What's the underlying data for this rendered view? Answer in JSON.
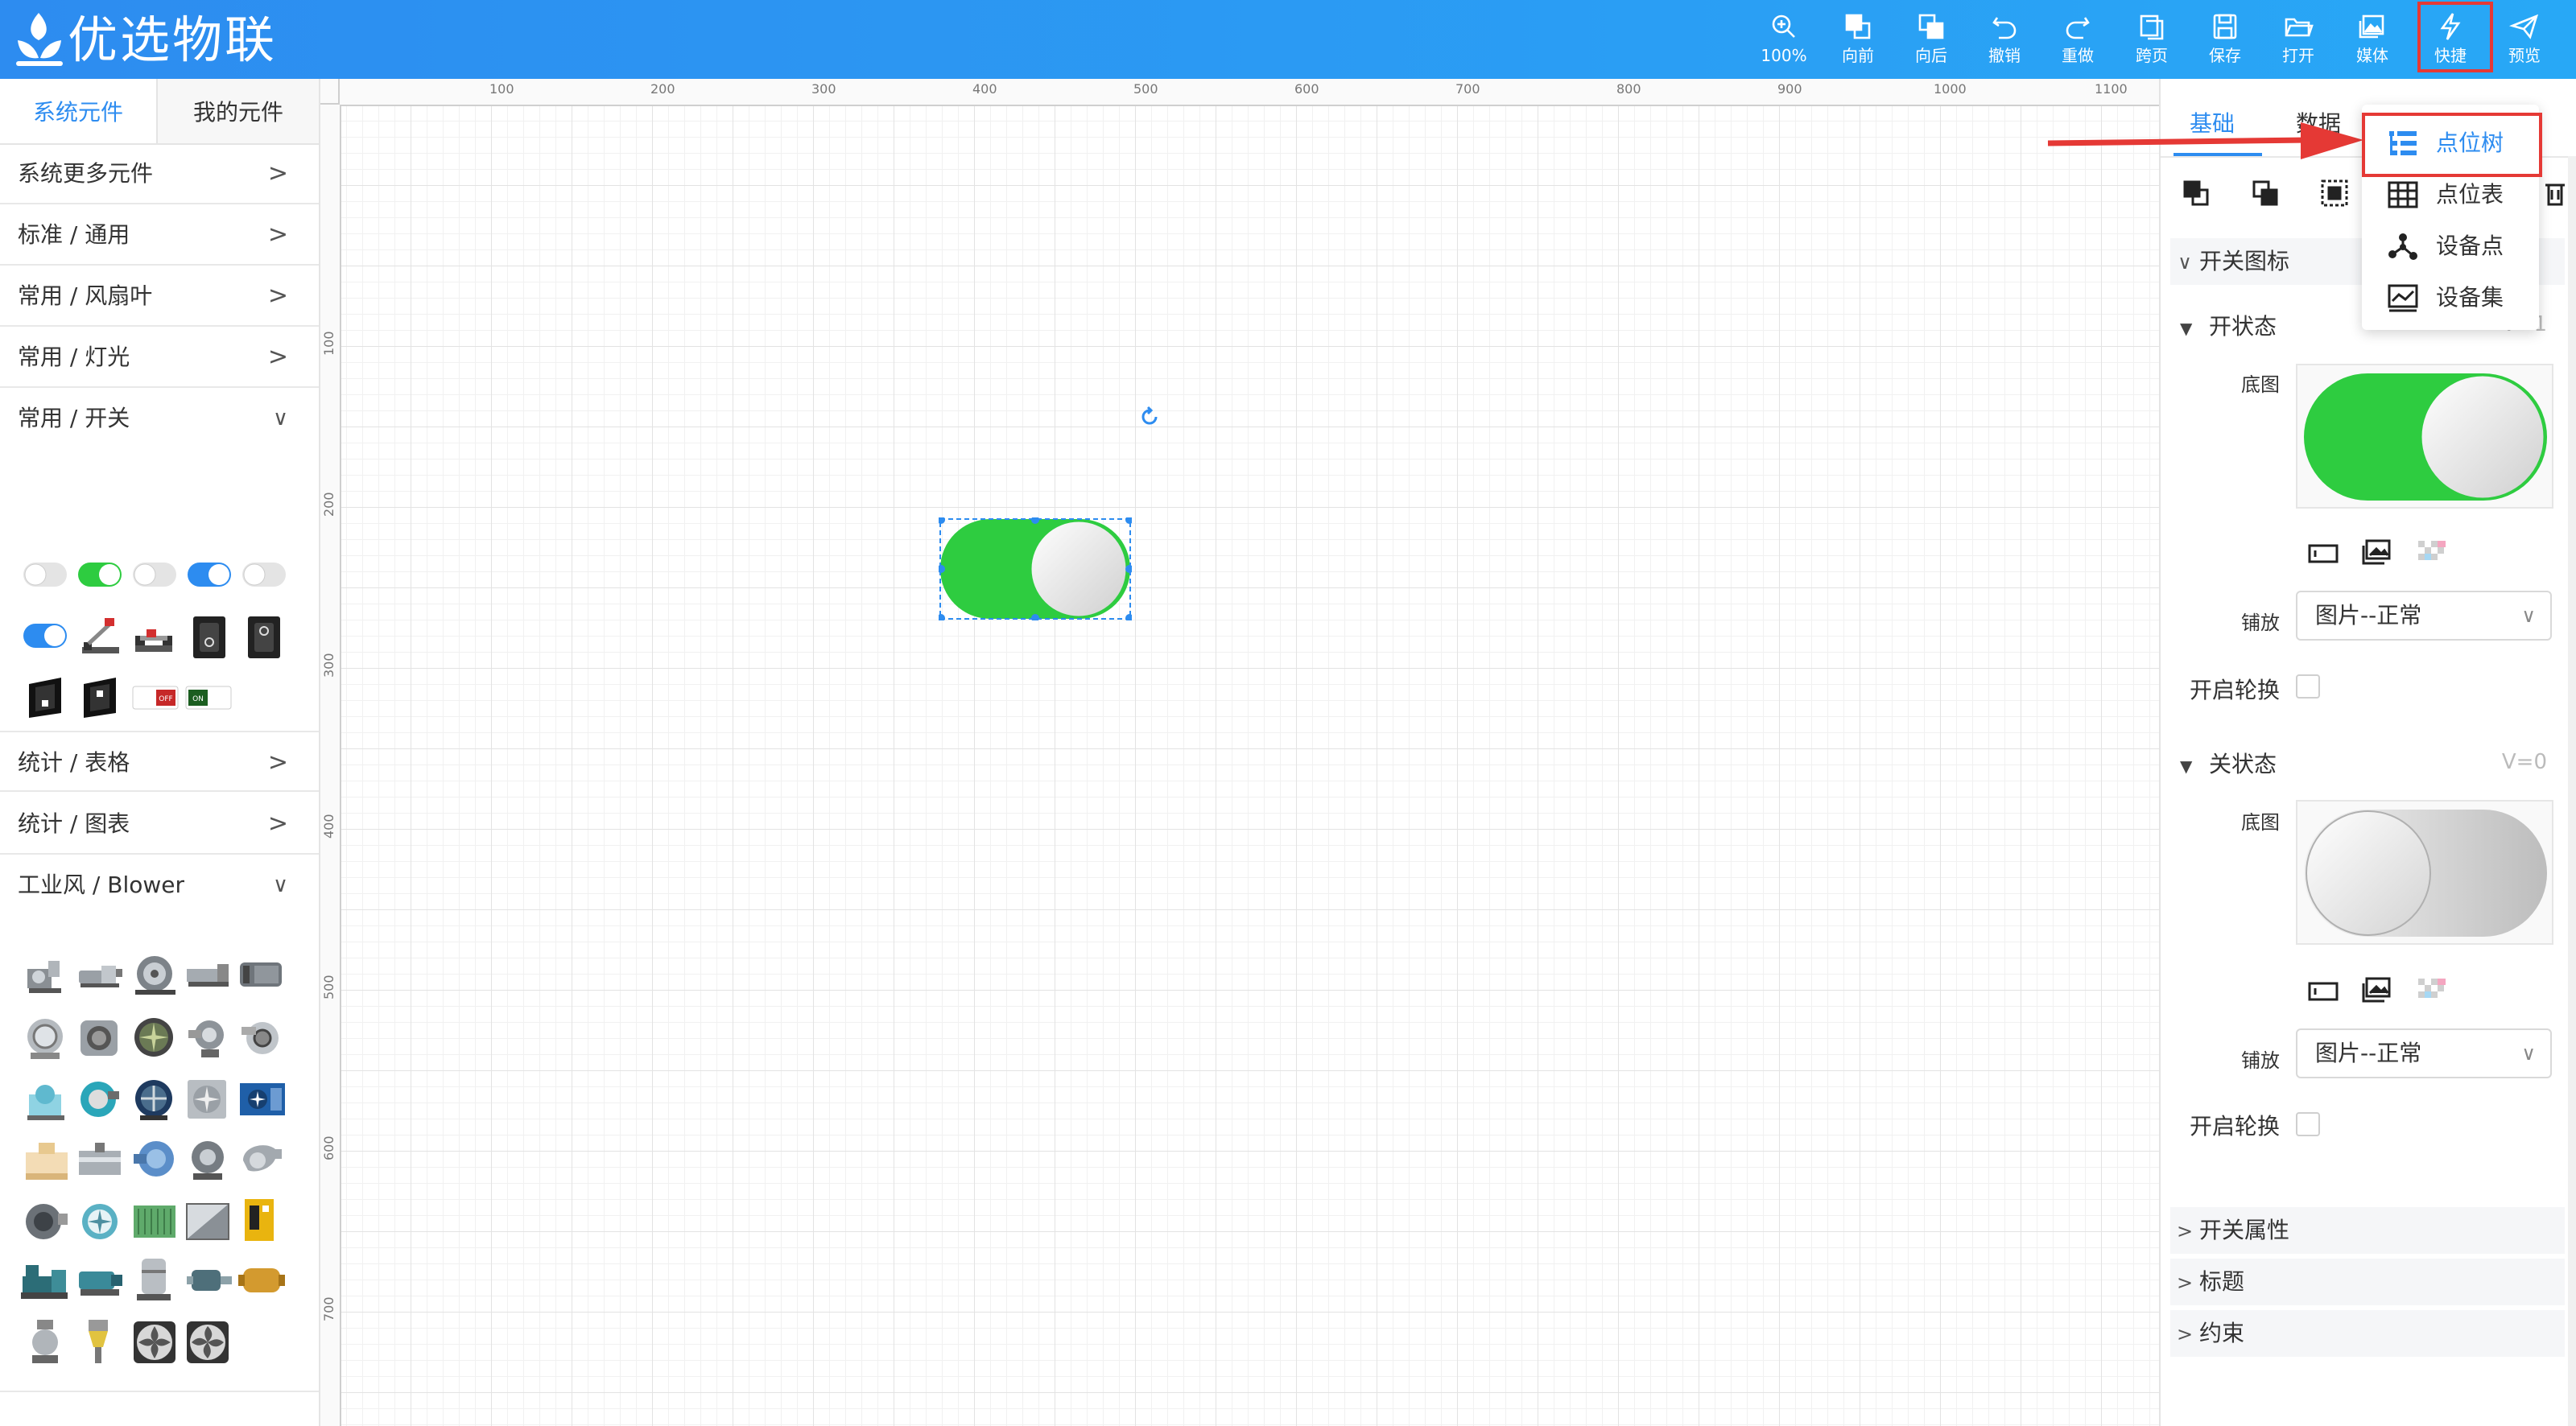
{
  "app": {
    "title": "优选物联"
  },
  "toolbar": [
    {
      "id": "zoom",
      "label": "100%",
      "icon": "zoom-in-icon"
    },
    {
      "id": "forward",
      "label": "向前",
      "icon": "bring-forward-icon"
    },
    {
      "id": "backward",
      "label": "向后",
      "icon": "send-backward-icon"
    },
    {
      "id": "undo",
      "label": "撤销",
      "icon": "undo-icon"
    },
    {
      "id": "redo",
      "label": "重做",
      "icon": "redo-icon"
    },
    {
      "id": "crosspage",
      "label": "跨页",
      "icon": "copy-page-icon"
    },
    {
      "id": "save",
      "label": "保存",
      "icon": "save-icon"
    },
    {
      "id": "open",
      "label": "打开",
      "icon": "folder-open-icon"
    },
    {
      "id": "media",
      "label": "媒体",
      "icon": "media-icon"
    },
    {
      "id": "quick",
      "label": "快捷",
      "icon": "lightning-icon"
    },
    {
      "id": "preview",
      "label": "预览",
      "icon": "send-icon"
    }
  ],
  "left_panel": {
    "tabs": [
      "系统元件",
      "我的元件"
    ],
    "active_tab": 0,
    "categories": [
      {
        "label": "系统更多元件",
        "expanded": false
      },
      {
        "label": "标准 / 通用",
        "expanded": false
      },
      {
        "label": "常用 / 风扇叶",
        "expanded": false
      },
      {
        "label": "常用 / 灯光",
        "expanded": false
      },
      {
        "label": "常用 / 开关",
        "expanded": true
      },
      {
        "label": "统计 / 表格",
        "expanded": false
      },
      {
        "label": "统计 / 图表",
        "expanded": false
      },
      {
        "label": "工业风 / Blower",
        "expanded": true
      }
    ],
    "chevron_right": ">",
    "chevron_down": "∨",
    "switch_off_text": "OFF",
    "switch_on_text": "ON"
  },
  "canvas": {
    "ruler_top_labels": [
      "100",
      "200",
      "300",
      "400",
      "500",
      "600",
      "700",
      "800",
      "900",
      "1000",
      "1100"
    ],
    "ruler_left_labels": [
      "100",
      "200",
      "300",
      "400",
      "500",
      "600",
      "700"
    ]
  },
  "right_panel": {
    "tabs": [
      "基础",
      "数据"
    ],
    "active_tab": 0,
    "section_switch_icon": "开关图标",
    "on_state": {
      "label": "开状态",
      "value": "V=1"
    },
    "off_state": {
      "label": "关状态",
      "value": "V=0"
    },
    "base_image_label": "底图",
    "tile_label": "铺放",
    "tile_value": "图片--正常",
    "rotate_label": "开启轮换",
    "sections_collapsed": [
      "开关属性",
      "标题",
      "约束"
    ]
  },
  "quick_menu": {
    "items": [
      {
        "label": "点位树",
        "icon": "tree-list-icon",
        "highlighted": true
      },
      {
        "label": "点位表",
        "icon": "table-icon",
        "highlighted": false
      },
      {
        "label": "设备点",
        "icon": "node-graph-icon",
        "highlighted": false
      },
      {
        "label": "设备集",
        "icon": "device-set-icon",
        "highlighted": false
      }
    ]
  },
  "colors": {
    "toolbar_bg": "#2d8cf0",
    "accent": "#2d8cf0",
    "switch_green": "#2ecc40",
    "highlight_red": "#e53935"
  }
}
